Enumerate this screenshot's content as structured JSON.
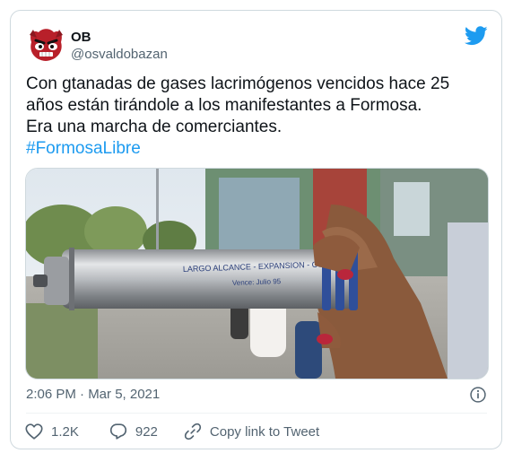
{
  "tweet": {
    "author": {
      "display_name": "OB",
      "handle": "@osvaldobazan",
      "avatar_icon": "angry-face-avatar"
    },
    "text_lines": [
      "Con gtanadas de gases lacrimógenos vencidos hace 25",
      "años están tirándole a los manifestantes a Formosa.",
      "Era una marcha de comerciantes."
    ],
    "hashtag": "#FormosaLibre",
    "media": {
      "canister_label": "LARGO ALCANCE - EXPANSION - CS",
      "canister_expiry": "Vence: Julio 95"
    },
    "timestamp": "2:06 PM · Mar 5, 2021",
    "actions": {
      "likes_count": "1.2K",
      "replies_count": "922",
      "copy_link_label": "Copy link to Tweet"
    }
  },
  "colors": {
    "accent": "#1d9bf0",
    "text_primary": "#0f1419",
    "text_secondary": "#536471",
    "border": "#cfd9de"
  },
  "icons": [
    "twitter-bird-icon",
    "info-icon",
    "heart-icon",
    "reply-icon",
    "link-icon"
  ]
}
